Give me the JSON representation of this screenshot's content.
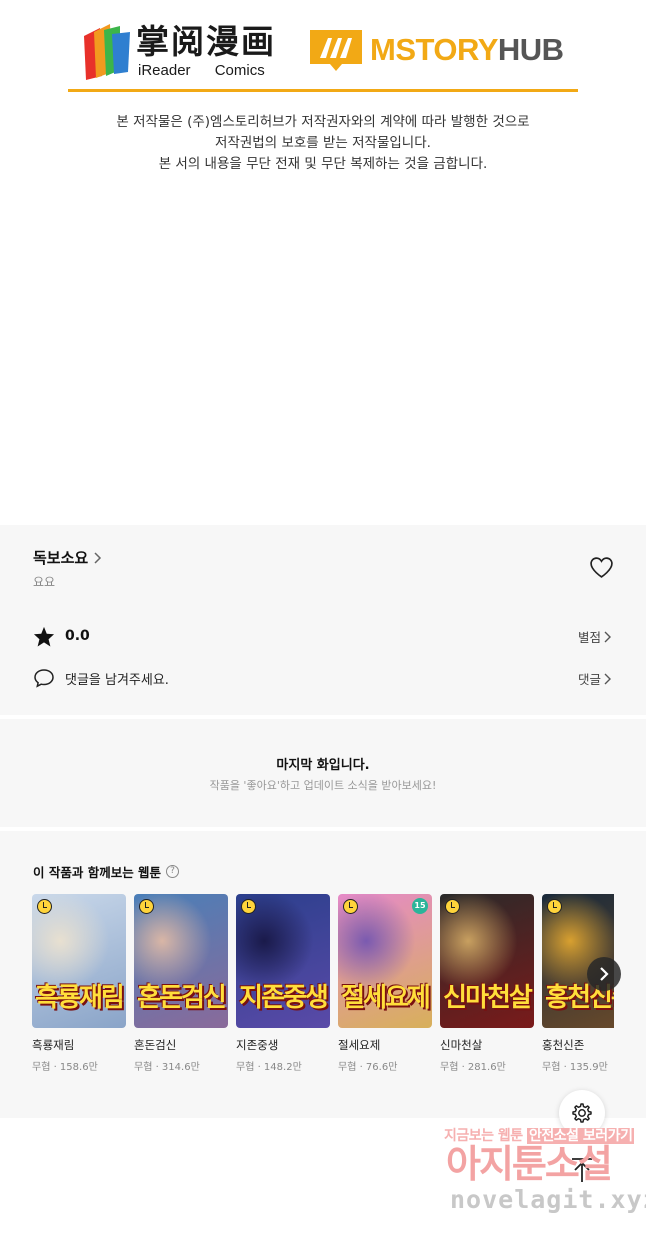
{
  "banner": {
    "ireader_cn": "掌阅漫画",
    "ireader_en": "iReader Comics",
    "mstory_a": "MSTORY",
    "mstory_b": "HUB",
    "notice_lines": [
      "본 저작물은 (주)엠스토리허브가 저작권자와의 계약에 따라 발행한 것으로",
      "저작권법의 보호를 받는 저작물입니다.",
      "본 서의 내용을 무단 전재 및 무단 복제하는 것을 금합니다."
    ],
    "accent_color": "#f2a915"
  },
  "info": {
    "title": "독보소요",
    "author": "요요",
    "rating": "0.0",
    "rating_link": "별점",
    "comment_prompt": "댓글을 남겨주세요.",
    "comment_link": "댓글"
  },
  "last_episode": {
    "title": "마지막 화입니다.",
    "subtitle": "작품을 '좋아요'하고 업데이트 소식을 받아보세요!"
  },
  "recommendations": {
    "heading": "이 작품과 함께보는 웹툰",
    "items": [
      {
        "title": "흑룡재림",
        "meta": "무협 · 158.6만",
        "cover_text": "흑룡재림",
        "colors": [
          "#c9d8ea",
          "#8aa4c8",
          "#e8e0d0"
        ],
        "badge": ""
      },
      {
        "title": "혼돈검신",
        "meta": "무협 · 314.6만",
        "cover_text": "혼돈검신",
        "colors": [
          "#4a7fb8",
          "#8a6a9a",
          "#d9b6a6"
        ],
        "badge": ""
      },
      {
        "title": "지존중생",
        "meta": "무협 · 148.2만",
        "cover_text": "지존중생",
        "colors": [
          "#2b3f8c",
          "#5a4aa8",
          "#1a1a4a"
        ],
        "badge": ""
      },
      {
        "title": "절세요제",
        "meta": "무협 · 76.6만",
        "cover_text": "절세요제",
        "colors": [
          "#e58ac8",
          "#d8b05a",
          "#7a5ab0"
        ],
        "badge": "15"
      },
      {
        "title": "신마천살",
        "meta": "무협 · 281.6만",
        "cover_text": "신마천살",
        "colors": [
          "#2a2a2a",
          "#7a1a1a",
          "#c8a060"
        ],
        "badge": ""
      },
      {
        "title": "홍천신존",
        "meta": "무협 · 135.9만",
        "cover_text": "홍천신존",
        "colors": [
          "#1a2a3a",
          "#6a4a2a",
          "#d8a030"
        ],
        "badge": ""
      }
    ]
  },
  "watermark": {
    "line1_a": "지금보는 웹툰 ",
    "line1_b": "안전소설 보러가기",
    "line2": "아지툰소설",
    "line3": "novelagit.xyz"
  }
}
